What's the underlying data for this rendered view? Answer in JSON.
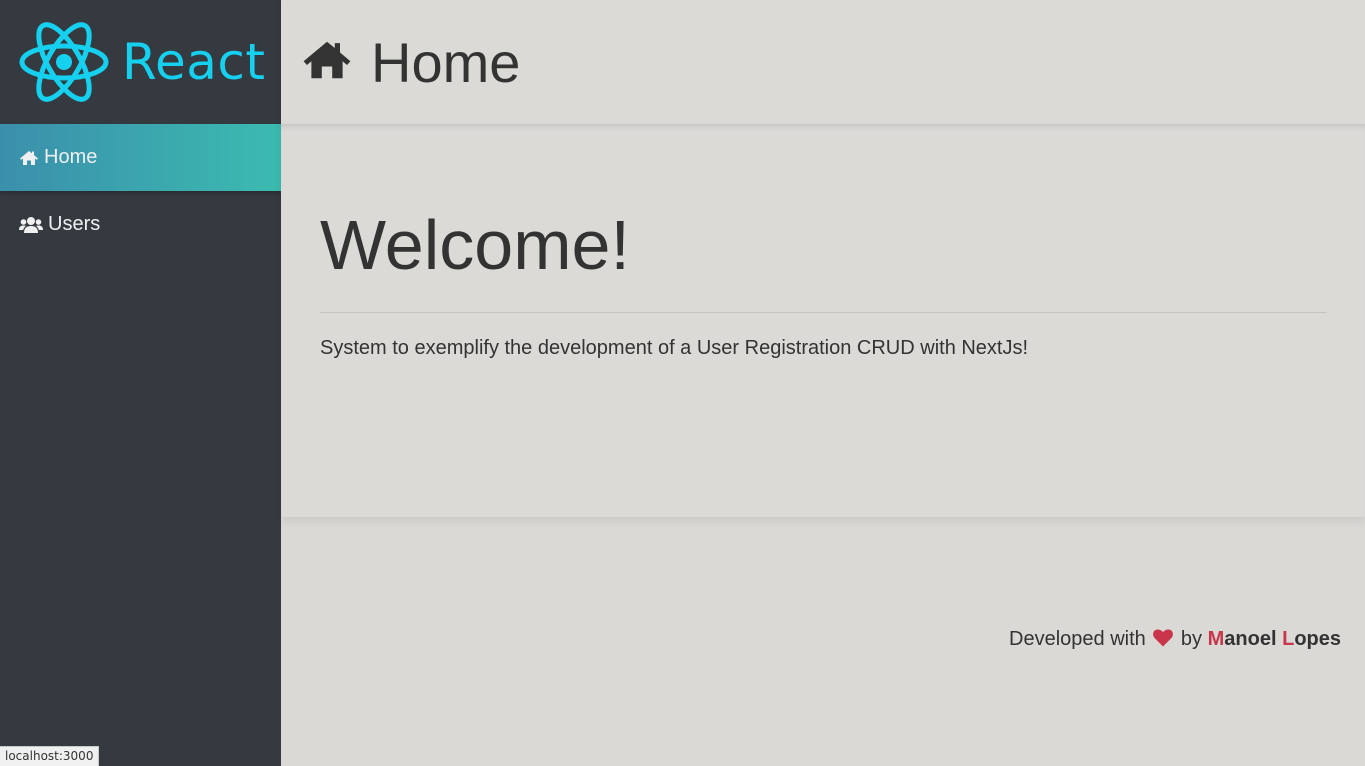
{
  "brand": {
    "logo_text": "React",
    "logo_icon": "react-atom-icon",
    "logo_color": "#16d0f0"
  },
  "sidebar": {
    "items": [
      {
        "label": "Home",
        "icon": "home-icon",
        "active": true
      },
      {
        "label": "Users",
        "icon": "users-icon",
        "active": false
      }
    ]
  },
  "header": {
    "title": "Home",
    "icon": "home-icon"
  },
  "main": {
    "heading": "Welcome!",
    "description": "System to exemplify the development of a User Registration CRUD with NextJs!"
  },
  "footer": {
    "prefix": "Developed with",
    "heart_icon": "heart-icon",
    "middle": "by",
    "author_first_initial": "M",
    "author_first_rest": "anoel",
    "author_last_initial": "L",
    "author_last_rest": "opes",
    "accent_color": "#c9364b"
  },
  "status_bar": {
    "url": "localhost:3000"
  },
  "colors": {
    "sidebar_bg": "#343a3f",
    "page_bg": "#dbd9d6",
    "active_from": "#3b8fac",
    "active_to": "#3bbbb0"
  }
}
